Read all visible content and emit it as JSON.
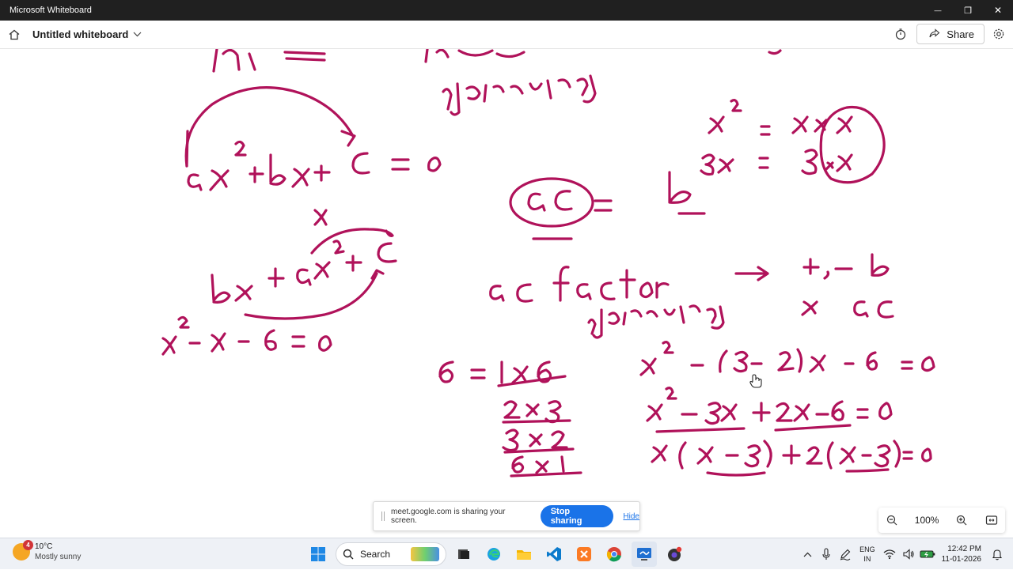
{
  "window": {
    "title": "Microsoft Whiteboard",
    "minimize": "—",
    "maximize": "❐",
    "close": "✕"
  },
  "header": {
    "doc_title": "Untitled whiteboard",
    "share_label": "Share"
  },
  "sharing": {
    "message": "meet.google.com is sharing your screen.",
    "stop_label": "Stop sharing",
    "hide_label": "Hide"
  },
  "zoom": {
    "level": "100%"
  },
  "accent": "#b0125a",
  "taskbar": {
    "weather_temp": "10°C",
    "weather_desc": "Mostly sunny",
    "weather_badge": "4",
    "search_label": "Search",
    "lang_top": "ENG",
    "lang_bottom": "IN",
    "time": "12:42 PM",
    "date": "11-01-2026"
  }
}
